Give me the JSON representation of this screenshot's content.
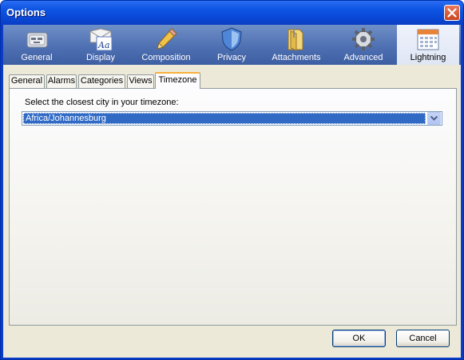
{
  "window": {
    "title": "Options"
  },
  "panes": [
    {
      "id": "general",
      "label": "General",
      "icon": "general-settings-icon"
    },
    {
      "id": "display",
      "label": "Display",
      "icon": "display-font-icon"
    },
    {
      "id": "composition",
      "label": "Composition",
      "icon": "pencil-icon"
    },
    {
      "id": "privacy",
      "label": "Privacy",
      "icon": "shield-icon"
    },
    {
      "id": "attachments",
      "label": "Attachments",
      "icon": "folder-icon"
    },
    {
      "id": "advanced",
      "label": "Advanced",
      "icon": "gear-icon"
    },
    {
      "id": "lightning",
      "label": "Lightning",
      "icon": "calendar-icon",
      "selected": true
    }
  ],
  "tabs": [
    {
      "label": "General"
    },
    {
      "label": "Alarms"
    },
    {
      "label": "Categories"
    },
    {
      "label": "Views"
    },
    {
      "label": "Timezone",
      "selected": true
    }
  ],
  "timezone": {
    "prompt": "Select the closest city in your timezone:",
    "selected_value": "Africa/Johannesburg"
  },
  "buttons": {
    "ok": "OK",
    "cancel": "Cancel"
  },
  "colors": {
    "titlebar": "#0a48d6",
    "selection": "#316ac5",
    "tab_accent": "#f7b03d"
  }
}
